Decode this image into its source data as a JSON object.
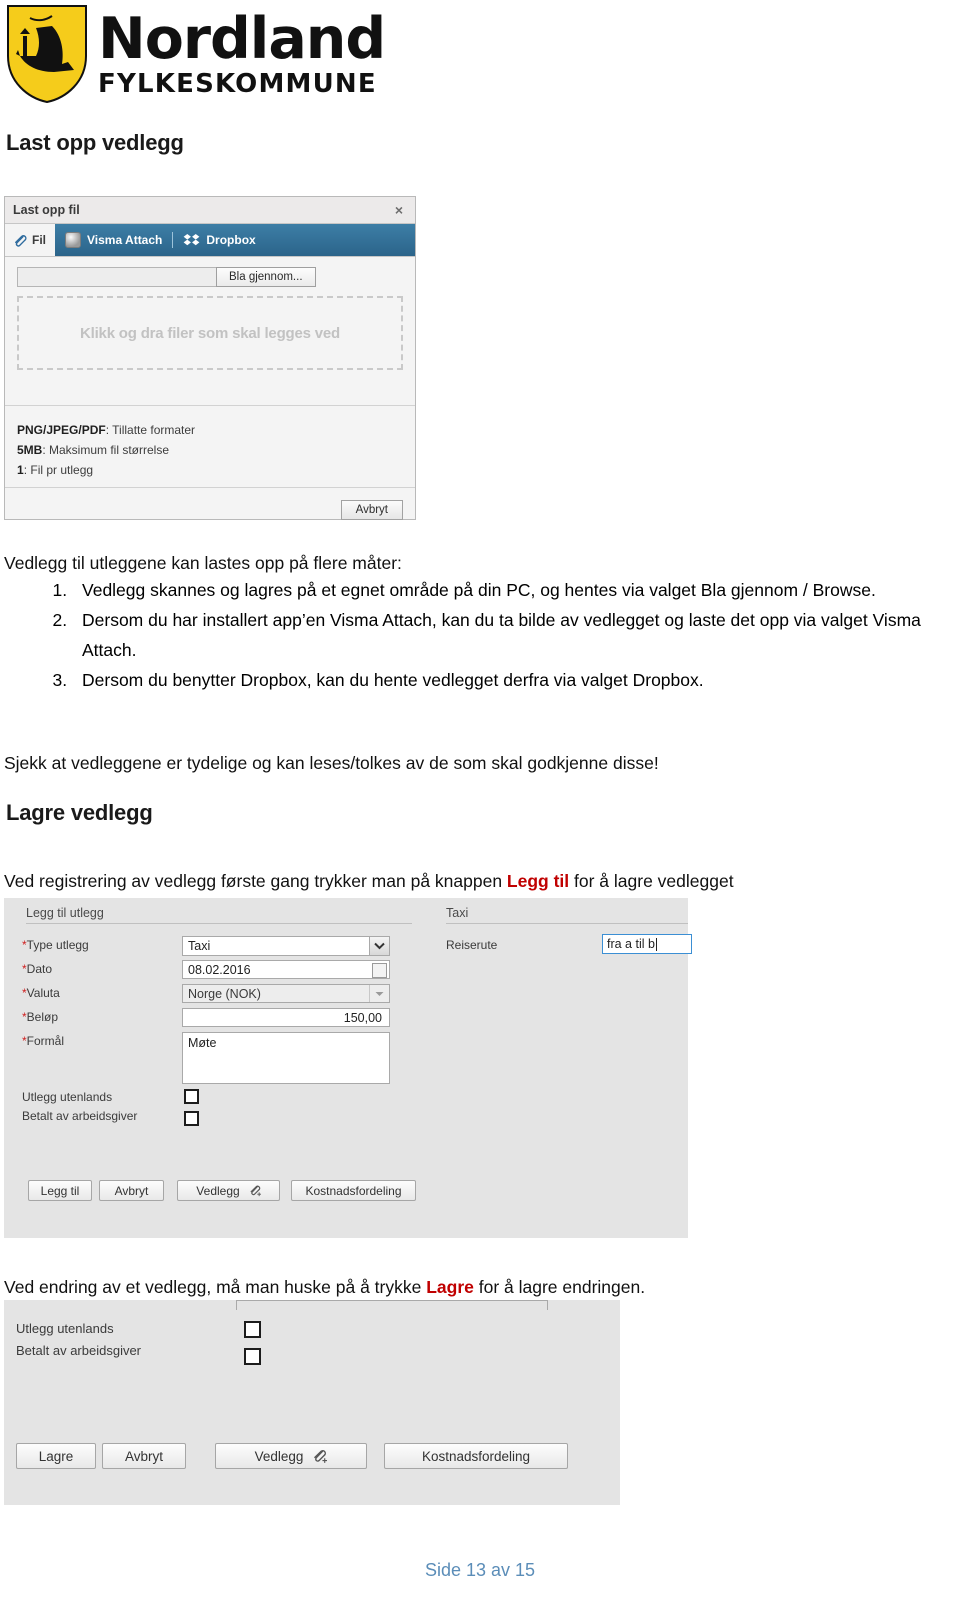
{
  "logo": {
    "name": "Nordland",
    "subtitle": "FYLKESKOMMUNE",
    "shield_color": "#f5cc1b"
  },
  "headings": {
    "upload": "Last opp vedlegg",
    "save": "Lagre vedlegg"
  },
  "upload_dialog": {
    "title": "Last opp fil",
    "close_label": "×",
    "tabs": [
      {
        "label": "Fil",
        "icon": "paperclip-icon",
        "active": false
      },
      {
        "label": "Visma Attach",
        "icon": "visma-attach-icon",
        "active": true
      },
      {
        "label": "Dropbox",
        "icon": "dropbox-icon",
        "active": true
      }
    ],
    "browse_button": "Bla gjennom...",
    "file_field_value": "",
    "dropzone_text": "Klikk og dra filer som skal legges ved",
    "info": [
      {
        "key": "PNG/JPEG/PDF",
        "value": "Tillatte formater"
      },
      {
        "key": "5MB",
        "value": "Maksimum fil størrelse"
      },
      {
        "key": "1",
        "value": "Fil pr utlegg"
      }
    ],
    "cancel_button": "Avbryt"
  },
  "body": {
    "intro": "Vedlegg til utleggene kan lastes opp på flere måter:",
    "steps": [
      "Vedlegg skannes og lagres på et egnet område på din PC, og hentes via valget Bla gjennom / Browse.",
      "Dersom du har installert app’en Visma Attach, kan du ta bilde av vedlegget og laste det opp via valget Visma Attach.",
      "Dersom du benytter Dropbox, kan du hente vedlegget derfra via valget Dropbox."
    ],
    "check_note": "Sjekk at vedleggene er tydelige og kan leses/tolkes av de som skal godkjenne disse!",
    "first_time_note": {
      "before": "Ved registrering av vedlegg første gang trykker man på knappen ",
      "highlight": "Legg til",
      "after": " for å lagre vedlegget"
    },
    "edit_note": {
      "before": "Ved endring av et vedlegg, må man huske på å trykke ",
      "highlight": "Lagre",
      "after": " for å lagre endringen."
    },
    "highlight_color": "#c00000"
  },
  "expense_form": {
    "section_title": "Legg til utlegg",
    "right_section_title": "Taxi",
    "fields": {
      "type_label": "Type utlegg",
      "type_value": "Taxi",
      "date_label": "Dato",
      "date_value": "08.02.2016",
      "currency_label": "Valuta",
      "currency_value": "Norge (NOK)",
      "amount_label": "Beløp",
      "amount_value": "150,00",
      "purpose_label": "Formål",
      "purpose_value": "Møte",
      "abroad_label": "Utlegg utenlands",
      "abroad_checked": false,
      "paid_by_employer_label": "Betalt av arbeidsgiver",
      "paid_by_employer_checked": false,
      "route_label": "Reiserute",
      "route_value": "fra a til b"
    },
    "buttons": [
      {
        "label": "Legg til",
        "icon": ""
      },
      {
        "label": "Avbryt",
        "icon": ""
      },
      {
        "label": "Vedlegg",
        "icon": "paperclip-plus-icon"
      },
      {
        "label": "Kostnadsfordeling",
        "icon": ""
      }
    ]
  },
  "edit_form": {
    "fields": {
      "abroad_label": "Utlegg utenlands",
      "abroad_checked": false,
      "paid_by_employer_label": "Betalt av arbeidsgiver",
      "paid_by_employer_checked": false
    },
    "buttons": [
      {
        "label": "Lagre",
        "icon": ""
      },
      {
        "label": "Avbryt",
        "icon": ""
      },
      {
        "label": "Vedlegg",
        "icon": "paperclip-plus-icon"
      },
      {
        "label": "Kostnadsfordeling",
        "icon": ""
      }
    ]
  },
  "footer": {
    "page_text": "Side 13 av 15",
    "color": "#5b8db8"
  }
}
